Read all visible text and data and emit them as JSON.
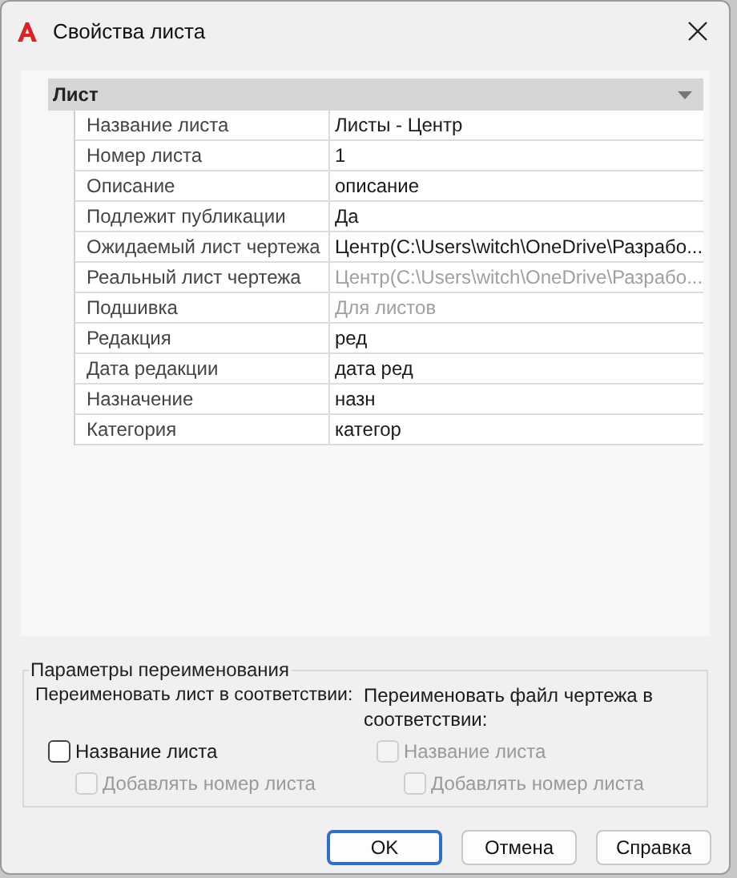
{
  "window": {
    "title": "Свойства листа"
  },
  "property_grid": {
    "category": {
      "label": "Лист",
      "expanded": true
    },
    "rows": [
      {
        "label": "Название листа",
        "value": "Листы - Центр",
        "disabled": false
      },
      {
        "label": "Номер листа",
        "value": "1",
        "disabled": false
      },
      {
        "label": "Описание",
        "value": "описание",
        "disabled": false
      },
      {
        "label": "Подлежит публикации",
        "value": "Да",
        "disabled": false
      },
      {
        "label": "Ожидаемый лист чертежа",
        "value": "Центр(C:\\Users\\witch\\OneDrive\\Разрабо...",
        "disabled": false
      },
      {
        "label": "Реальный лист чертежа",
        "value": "Центр(C:\\Users\\witch\\OneDrive\\Разрабо...",
        "disabled": true
      },
      {
        "label": "Подшивка",
        "value": "Для листов",
        "disabled": true
      },
      {
        "label": "Редакция",
        "value": "ред",
        "disabled": false
      },
      {
        "label": "Дата редакции",
        "value": "дата ред",
        "disabled": false
      },
      {
        "label": "Назначение",
        "value": "назн",
        "disabled": false
      },
      {
        "label": "Категория",
        "value": "категор",
        "disabled": false
      }
    ]
  },
  "rename_options": {
    "title": "Параметры переименования",
    "columns": [
      {
        "heading": "Переименовать лист в соответствии:",
        "checkboxes": [
          {
            "label": "Название листа",
            "checked": false,
            "disabled": false
          },
          {
            "label": "Добавлять номер листа",
            "checked": false,
            "disabled": true
          }
        ]
      },
      {
        "heading": "Переименовать файл чертежа в соответствии:",
        "checkboxes": [
          {
            "label": "Название листа",
            "checked": false,
            "disabled": true
          },
          {
            "label": "Добавлять номер листа",
            "checked": false,
            "disabled": true
          }
        ]
      }
    ]
  },
  "buttons": [
    {
      "label": "OK",
      "default": true
    },
    {
      "label": "Отмена",
      "default": false
    },
    {
      "label": "Справка",
      "default": false
    }
  ]
}
